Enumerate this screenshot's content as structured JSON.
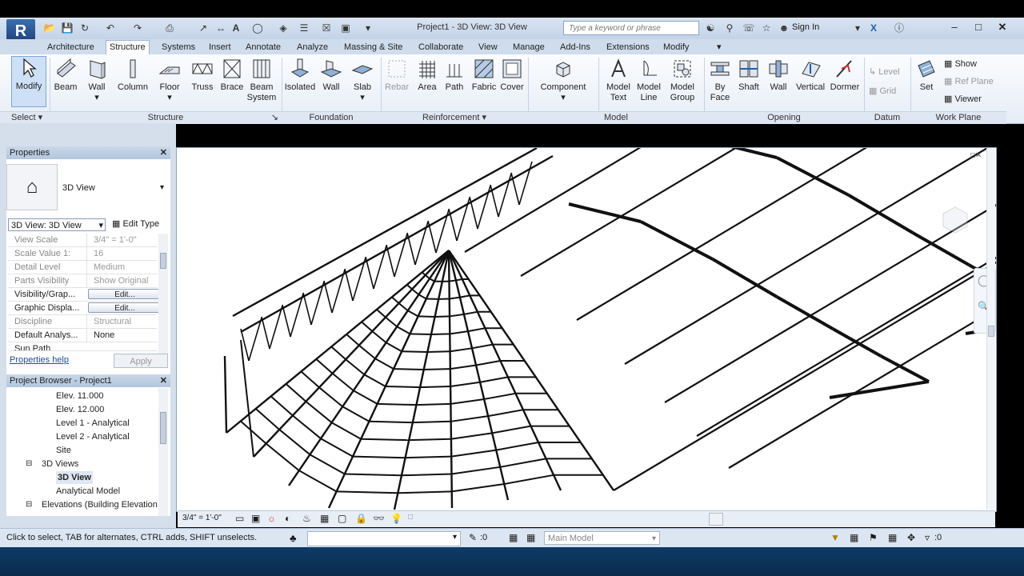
{
  "app": {
    "logo_letter": "R",
    "title": "Project1 - 3D View: 3D View",
    "search_placeholder": "Type a keyword or phrase",
    "sign_in": "Sign In"
  },
  "tabs": [
    {
      "label": "Architecture",
      "active": false
    },
    {
      "label": "Structure",
      "active": true
    },
    {
      "label": "Systems",
      "active": false
    },
    {
      "label": "Insert",
      "active": false
    },
    {
      "label": "Annotate",
      "active": false
    },
    {
      "label": "Analyze",
      "active": false
    },
    {
      "label": "Massing & Site",
      "active": false
    },
    {
      "label": "Collaborate",
      "active": false
    },
    {
      "label": "View",
      "active": false
    },
    {
      "label": "Manage",
      "active": false
    },
    {
      "label": "Add-Ins",
      "active": false
    },
    {
      "label": "Extensions",
      "active": false
    },
    {
      "label": "Modify",
      "active": false
    }
  ],
  "ribbon": {
    "modify": "Modify",
    "select": "Select",
    "structure_tools": [
      "Beam",
      "Wall",
      "Column",
      "Floor",
      "Truss",
      "Brace",
      "Beam"
    ],
    "beam_system_line2": "System",
    "foundation_tools": [
      "Isolated",
      "Wall",
      "Slab"
    ],
    "reinforcement_tools": [
      "Rebar",
      "Area",
      "Path",
      "Fabric",
      "Cover"
    ],
    "component": "Component",
    "model_tools": [
      {
        "l1": "Model",
        "l2": "Text"
      },
      {
        "l1": "Model",
        "l2": "Line"
      },
      {
        "l1": "Model",
        "l2": "Group"
      }
    ],
    "opening_tools": [
      {
        "l1": "By",
        "l2": "Face"
      },
      {
        "l1": "Shaft",
        "l2": ""
      },
      {
        "l1": "Wall",
        "l2": ""
      },
      {
        "l1": "Vertical",
        "l2": ""
      },
      {
        "l1": "Dormer",
        "l2": ""
      }
    ],
    "datum_tools": [
      "Level",
      "Grid"
    ],
    "set": "Set",
    "work_plane_tools": [
      "Show",
      "Ref Plane",
      "Viewer"
    ],
    "panels": {
      "select": "Select",
      "structure": "Structure",
      "foundation": "Foundation",
      "reinforcement": "Reinforcement",
      "model": "Model",
      "opening": "Opening",
      "datum": "Datum",
      "work_plane": "Work Plane"
    }
  },
  "properties": {
    "header": "Properties",
    "type_name": "3D View",
    "selector": "3D View: 3D View",
    "edit_type": "Edit Type",
    "rows": [
      {
        "k": "View Scale",
        "v": "3/4\" = 1'-0\"",
        "enabled": false
      },
      {
        "k": "Scale Value   1:",
        "v": "16",
        "enabled": false
      },
      {
        "k": "Detail Level",
        "v": "Medium",
        "enabled": false
      },
      {
        "k": "Parts Visibility",
        "v": "Show Original",
        "enabled": false
      },
      {
        "k": "Visibility/Grap...",
        "v": "Edit...",
        "enabled": true,
        "button": true
      },
      {
        "k": "Graphic Displa...",
        "v": "Edit...",
        "enabled": true,
        "button": true
      },
      {
        "k": "Discipline",
        "v": "Structural",
        "enabled": false
      },
      {
        "k": "Default Analys...",
        "v": "None",
        "enabled": true
      },
      {
        "k": "Sun Path",
        "v": "",
        "enabled": true
      }
    ],
    "help_link": "Properties help",
    "apply": "Apply"
  },
  "project_browser": {
    "header": "Project Browser - Project1",
    "items": [
      {
        "label": "Elev. 11.000",
        "level": 2
      },
      {
        "label": "Elev. 12.000",
        "level": 2
      },
      {
        "label": "Level 1 - Analytical",
        "level": 2
      },
      {
        "label": "Level 2 - Analytical",
        "level": 2
      },
      {
        "label": "Site",
        "level": 2
      },
      {
        "label": "3D Views",
        "level": 1
      },
      {
        "label": "3D View",
        "level": 2,
        "selected": true
      },
      {
        "label": "Analytical Model",
        "level": 2
      },
      {
        "label": "Elevations (Building Elevation",
        "level": 1
      }
    ]
  },
  "view_control": {
    "scale": "3/4\" = 1'-0\""
  },
  "status": {
    "message": "Click to select, TAB for alternates, CTRL adds, SHIFT unselects.",
    "zero": ":0",
    "model": "Main Model",
    "filter_count": ":0"
  },
  "colors": {
    "ribbon_bg": "#eef3f9",
    "tab_bar": "#cfdcec",
    "taskbar": "#0e3a66"
  }
}
